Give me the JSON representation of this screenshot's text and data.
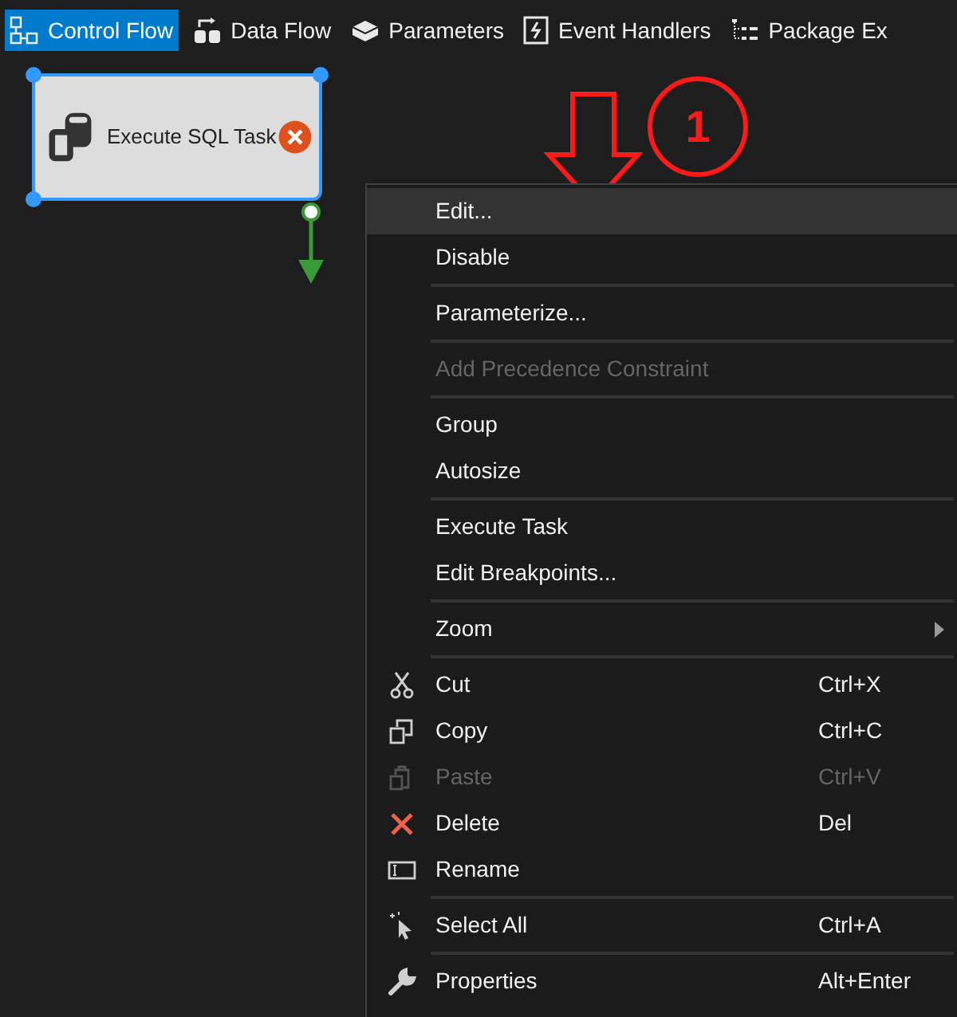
{
  "tabs": [
    {
      "label": "Control Flow",
      "selected": true
    },
    {
      "label": "Data Flow",
      "selected": false
    },
    {
      "label": "Parameters",
      "selected": false
    },
    {
      "label": "Event Handlers",
      "selected": false
    },
    {
      "label": "Package Ex",
      "selected": false
    }
  ],
  "task": {
    "title": "Execute SQL Task",
    "selected": true
  },
  "annotation": {
    "number": "1"
  },
  "context_menu": {
    "groups": [
      [
        {
          "label": "Edit...",
          "selected": true,
          "disabled": false
        },
        {
          "label": "Disable",
          "selected": false,
          "disabled": false
        }
      ],
      [
        {
          "label": "Parameterize...",
          "selected": false,
          "disabled": false
        }
      ],
      [
        {
          "label": "Add Precedence Constraint",
          "selected": false,
          "disabled": true
        }
      ],
      [
        {
          "label": "Group",
          "selected": false,
          "disabled": false
        },
        {
          "label": "Autosize",
          "selected": false,
          "disabled": false
        }
      ],
      [
        {
          "label": "Execute Task",
          "selected": false,
          "disabled": false
        },
        {
          "label": "Edit Breakpoints...",
          "selected": false,
          "disabled": false
        }
      ],
      [
        {
          "label": "Zoom",
          "selected": false,
          "disabled": false,
          "kind": "submenu"
        }
      ],
      [
        {
          "label": "Cut",
          "shortcut": "Ctrl+X",
          "selected": false,
          "disabled": false
        },
        {
          "label": "Copy",
          "shortcut": "Ctrl+C",
          "selected": false,
          "disabled": false
        },
        {
          "label": "Paste",
          "shortcut": "Ctrl+V",
          "selected": false,
          "disabled": true
        },
        {
          "label": "Delete",
          "shortcut": "Del",
          "selected": false,
          "disabled": false
        },
        {
          "label": "Rename",
          "selected": false,
          "disabled": false
        }
      ],
      [
        {
          "label": "Select All",
          "shortcut": "Ctrl+A",
          "selected": false,
          "disabled": false
        }
      ],
      [
        {
          "label": "Properties",
          "shortcut": "Alt+Enter",
          "selected": false,
          "disabled": false
        }
      ]
    ]
  }
}
